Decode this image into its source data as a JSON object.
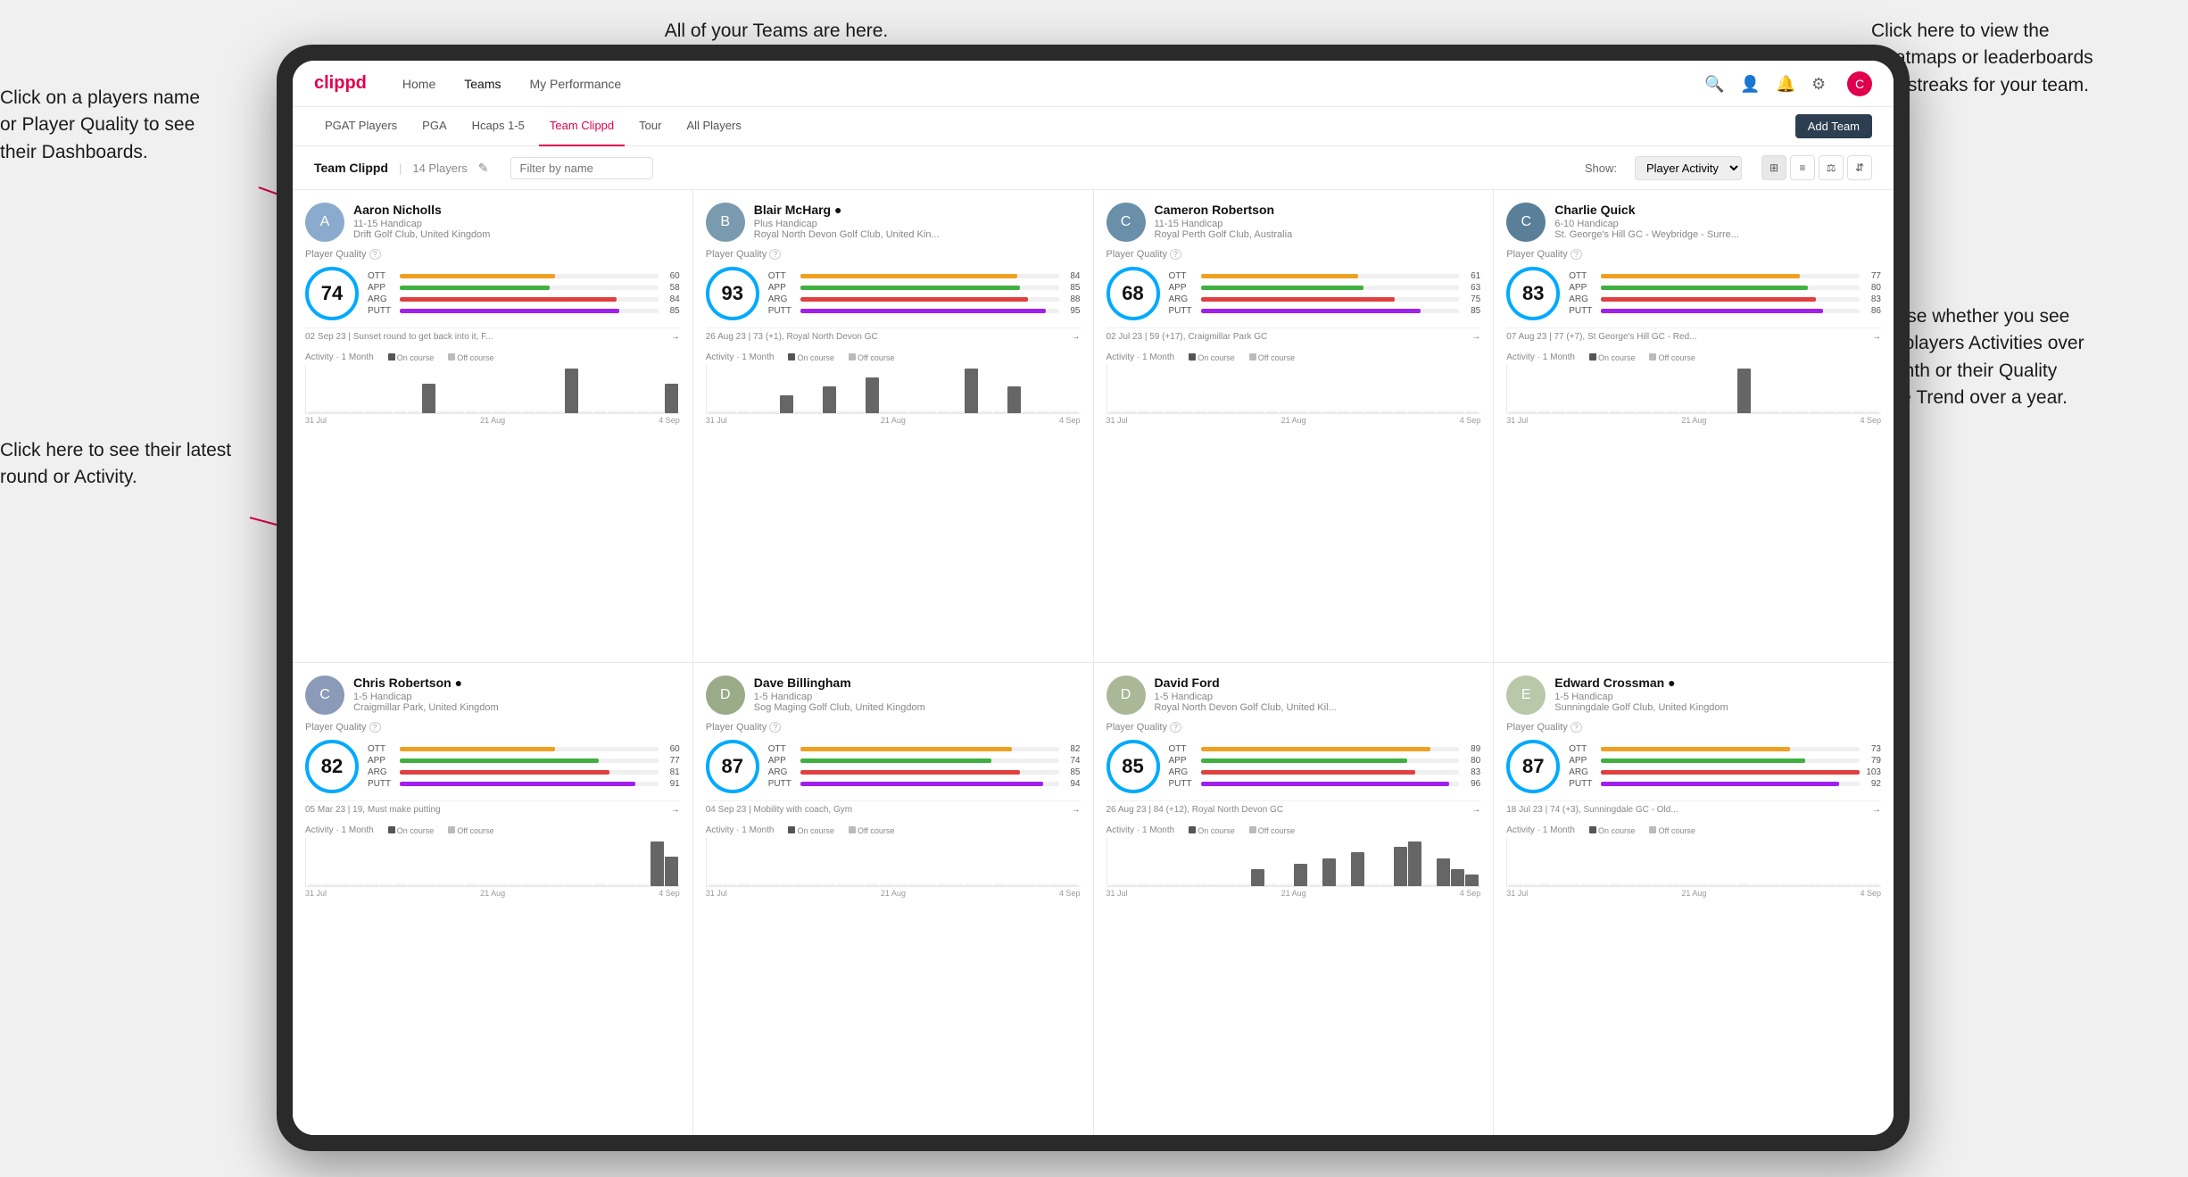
{
  "annotations": {
    "top_teams": "All of your Teams are here.",
    "right_heatmaps": "Click here to view the\nHeatmaps or leaderboards\nand streaks for your team.",
    "left_dashboards": "Click on a players name\nor Player Quality to see\ntheir Dashboards.",
    "left_activity": "Click here to see their latest\nround or Activity.",
    "right_activities": "Choose whether you see\nyour players Activities over\na month or their Quality\nScore Trend over a year."
  },
  "navbar": {
    "brand": "clippd",
    "links": [
      "Home",
      "Teams",
      "My Performance"
    ],
    "active": "Teams"
  },
  "subnav": {
    "links": [
      "PGAT Players",
      "PGA",
      "Hcaps 1-5",
      "Team Clippd",
      "Tour",
      "All Players"
    ],
    "active": "Team Clippd",
    "add_team": "Add Team"
  },
  "team_header": {
    "title": "Team Clippd",
    "separator": "|",
    "count": "14 Players",
    "search_placeholder": "Filter by name",
    "show_label": "Show:",
    "show_option": "Player Activity",
    "view_tooltip": "Grid view"
  },
  "players": [
    {
      "name": "Aaron Nicholls",
      "handicap": "11-15 Handicap",
      "club": "Drift Golf Club, United Kingdom",
      "quality": 74,
      "quality_color": "#00aaff",
      "ott": 60,
      "app": 58,
      "arg": 84,
      "putt": 85,
      "recent": "02 Sep 23 | Sunset round to get back into it, F...",
      "activity_bars": [
        0,
        0,
        0,
        0,
        0,
        0,
        0,
        0,
        2,
        0,
        0,
        0,
        0,
        0,
        0,
        0,
        0,
        0,
        3,
        0,
        0,
        0,
        0,
        0,
        0,
        2
      ],
      "dates": [
        "31 Jul",
        "21 Aug",
        "4 Sep"
      ],
      "avatar_color": "#8aabcd",
      "avatar_letter": "A"
    },
    {
      "name": "Blair McHarg",
      "handicap": "Plus Handicap",
      "club": "Royal North Devon Golf Club, United Kin...",
      "quality": 93,
      "quality_color": "#00aaff",
      "ott": 84,
      "app": 85,
      "arg": 88,
      "putt": 95,
      "recent": "26 Aug 23 | 73 (+1), Royal North Devon GC",
      "activity_bars": [
        0,
        0,
        0,
        0,
        0,
        2,
        0,
        0,
        3,
        0,
        0,
        4,
        0,
        0,
        0,
        0,
        0,
        0,
        5,
        0,
        0,
        3,
        0,
        0,
        0,
        0
      ],
      "dates": [
        "31 Jul",
        "21 Aug",
        "4 Sep"
      ],
      "avatar_color": "#7a9ab0",
      "avatar_letter": "B"
    },
    {
      "name": "Cameron Robertson",
      "handicap": "11-15 Handicap",
      "club": "Royal Perth Golf Club, Australia",
      "quality": 68,
      "quality_color": "#00aaff",
      "ott": 61,
      "app": 63,
      "arg": 75,
      "putt": 85,
      "recent": "02 Jul 23 | 59 (+17), Craigmillar Park GC",
      "activity_bars": [
        0,
        0,
        0,
        0,
        0,
        0,
        0,
        0,
        0,
        0,
        0,
        0,
        0,
        0,
        0,
        0,
        0,
        0,
        0,
        0,
        0,
        0,
        0,
        0,
        0,
        0
      ],
      "dates": [
        "31 Jul",
        "21 Aug",
        "4 Sep"
      ],
      "avatar_color": "#6a8fa8",
      "avatar_letter": "C"
    },
    {
      "name": "Charlie Quick",
      "handicap": "6-10 Handicap",
      "club": "St. George's Hill GC - Weybridge - Surre...",
      "quality": 83,
      "quality_color": "#00aaff",
      "ott": 77,
      "app": 80,
      "arg": 83,
      "putt": 86,
      "recent": "07 Aug 23 | 77 (+7), St George's Hill GC - Red...",
      "activity_bars": [
        0,
        0,
        0,
        0,
        0,
        0,
        0,
        0,
        0,
        0,
        0,
        0,
        0,
        0,
        0,
        0,
        3,
        0,
        0,
        0,
        0,
        0,
        0,
        0,
        0,
        0
      ],
      "dates": [
        "31 Jul",
        "21 Aug",
        "4 Sep"
      ],
      "avatar_color": "#5a7f98",
      "avatar_letter": "C"
    },
    {
      "name": "Chris Robertson",
      "handicap": "1-5 Handicap",
      "club": "Craigmillar Park, United Kingdom",
      "quality": 82,
      "quality_color": "#00aaff",
      "ott": 60,
      "app": 77,
      "arg": 81,
      "putt": 91,
      "recent": "05 Mar 23 | 19, Must make putting",
      "activity_bars": [
        0,
        0,
        0,
        0,
        0,
        0,
        0,
        0,
        0,
        0,
        0,
        0,
        0,
        0,
        0,
        0,
        0,
        0,
        0,
        0,
        0,
        0,
        0,
        0,
        3,
        2
      ],
      "dates": [
        "31 Jul",
        "21 Aug",
        "4 Sep"
      ],
      "avatar_color": "#8a9ab8",
      "avatar_letter": "C"
    },
    {
      "name": "Dave Billingham",
      "handicap": "1-5 Handicap",
      "club": "Sog Maging Golf Club, United Kingdom",
      "quality": 87,
      "quality_color": "#00aaff",
      "ott": 82,
      "app": 74,
      "arg": 85,
      "putt": 94,
      "recent": "04 Sep 23 | Mobility with coach, Gym",
      "activity_bars": [
        0,
        0,
        0,
        0,
        0,
        0,
        0,
        0,
        0,
        0,
        0,
        0,
        0,
        0,
        0,
        0,
        0,
        0,
        0,
        0,
        0,
        0,
        0,
        0,
        0,
        0
      ],
      "dates": [
        "31 Jul",
        "21 Aug",
        "4 Sep"
      ],
      "avatar_color": "#9aab88",
      "avatar_letter": "D"
    },
    {
      "name": "David Ford",
      "handicap": "1-5 Handicap",
      "club": "Royal North Devon Golf Club, United Kil...",
      "quality": 85,
      "quality_color": "#00aaff",
      "ott": 89,
      "app": 80,
      "arg": 83,
      "putt": 96,
      "recent": "26 Aug 23 | 84 (+12), Royal North Devon GC",
      "activity_bars": [
        0,
        0,
        0,
        0,
        0,
        0,
        0,
        0,
        0,
        0,
        3,
        0,
        0,
        4,
        0,
        5,
        0,
        6,
        0,
        0,
        7,
        8,
        0,
        5,
        3,
        2
      ],
      "dates": [
        "31 Jul",
        "21 Aug",
        "4 Sep"
      ],
      "avatar_color": "#aab898",
      "avatar_letter": "D"
    },
    {
      "name": "Edward Crossman",
      "handicap": "1-5 Handicap",
      "club": "Sunningdale Golf Club, United Kingdom",
      "quality": 87,
      "quality_color": "#00aaff",
      "ott": 73,
      "app": 79,
      "arg": 103,
      "putt": 92,
      "recent": "18 Jul 23 | 74 (+3), Sunningdale GC - Old...",
      "activity_bars": [
        0,
        0,
        0,
        0,
        0,
        0,
        0,
        0,
        0,
        0,
        0,
        0,
        0,
        0,
        0,
        0,
        0,
        0,
        0,
        0,
        0,
        0,
        0,
        0,
        0,
        0
      ],
      "dates": [
        "31 Jul",
        "21 Aug",
        "4 Sep"
      ],
      "avatar_color": "#b8c8a8",
      "avatar_letter": "E"
    }
  ],
  "chart": {
    "activity_label": "Activity · 1 Month",
    "on_course_label": "On course",
    "off_course_label": "Off course",
    "oncourse_color": "#555",
    "offcourse_color": "#bbb"
  }
}
